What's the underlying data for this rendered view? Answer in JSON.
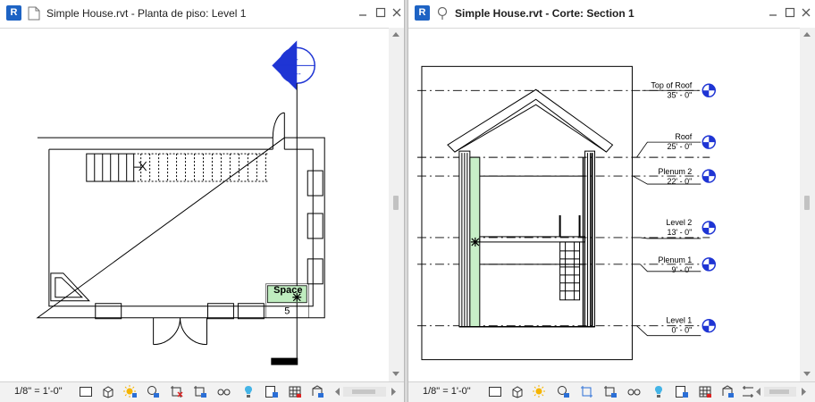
{
  "left_view": {
    "app_icon_label": "R",
    "view_icon": "floor-plan-view-icon",
    "title": "Simple House.rvt - Planta de piso: Level 1",
    "room_tag": {
      "name": "Space",
      "number": "5"
    },
    "section_head": {
      "top": "-",
      "bottom": "---"
    },
    "scale": "1/8\" = 1'-0\""
  },
  "right_view": {
    "app_icon_label": "R",
    "view_icon": "section-view-icon",
    "title": "Simple House.rvt - Corte: Section 1",
    "levels": [
      {
        "name": "Top of Roof",
        "elevation": "35' - 0\""
      },
      {
        "name": "Roof",
        "elevation": "25' - 0\""
      },
      {
        "name": "Plenum 2",
        "elevation": "22' - 0\""
      },
      {
        "name": "Level 2",
        "elevation": "13' - 0\""
      },
      {
        "name": "Plenum 1",
        "elevation": "9' - 0\""
      },
      {
        "name": "Level 1",
        "elevation": "0' - 0\""
      }
    ],
    "scale": "1/8\" = 1'-0\""
  },
  "colors": {
    "level_marker": "#1f35d4",
    "section_marker": "#1f35d4",
    "space_fill": "#bfecbf",
    "wall_fill": "#c8efc8"
  }
}
